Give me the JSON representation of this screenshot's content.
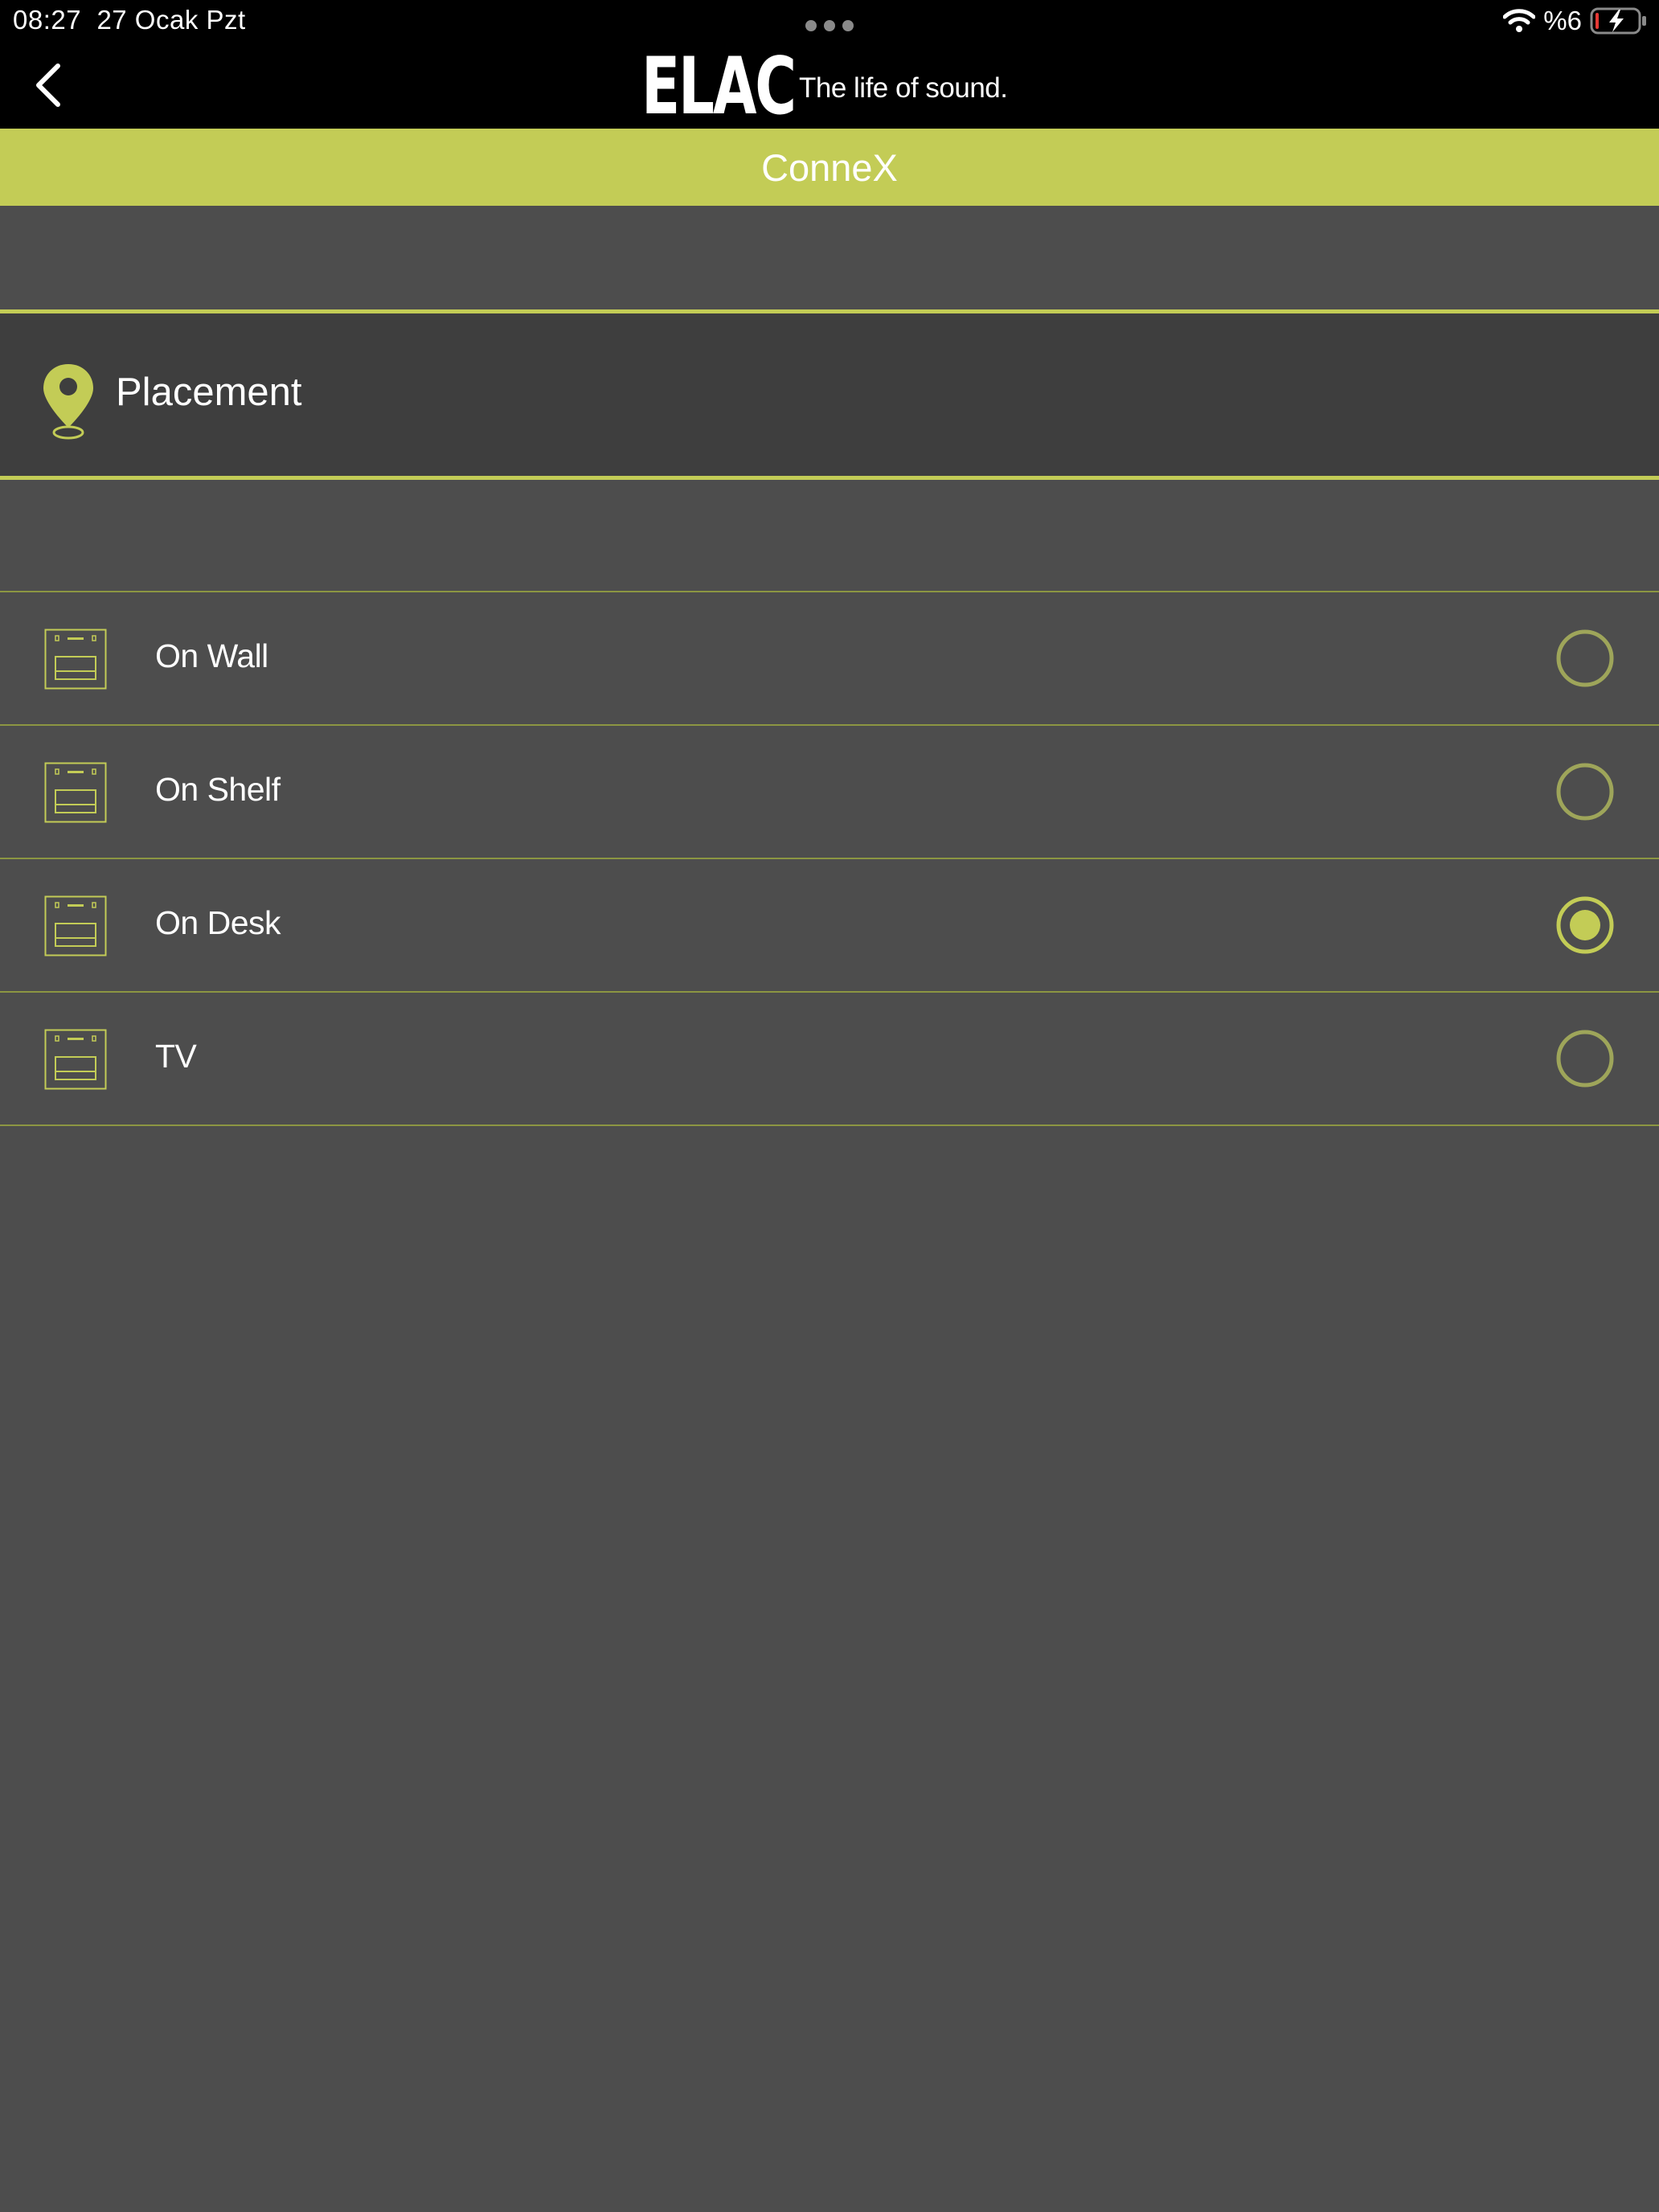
{
  "status_bar": {
    "time": "08:27",
    "date": "27 Ocak Pzt",
    "battery": "%6"
  },
  "nav": {
    "brand_logo": "ELAC",
    "brand_tagline": "The life of sound."
  },
  "title_bar": {
    "title": "ConneX"
  },
  "section": {
    "title": "Placement",
    "icon": "map-pin-icon"
  },
  "colors": {
    "accent": "#c3cc56",
    "background": "#4d4d4d",
    "header_background": "#3e3e3e",
    "divider": "#8c9642",
    "radio_unselected": "#9ea55a"
  },
  "placement_options": [
    {
      "label": "On Wall",
      "selected": false,
      "icon": "speaker-placement-icon"
    },
    {
      "label": "On Shelf",
      "selected": false,
      "icon": "speaker-placement-icon"
    },
    {
      "label": "On Desk",
      "selected": true,
      "icon": "speaker-placement-icon"
    },
    {
      "label": "TV",
      "selected": false,
      "icon": "speaker-placement-icon"
    }
  ]
}
